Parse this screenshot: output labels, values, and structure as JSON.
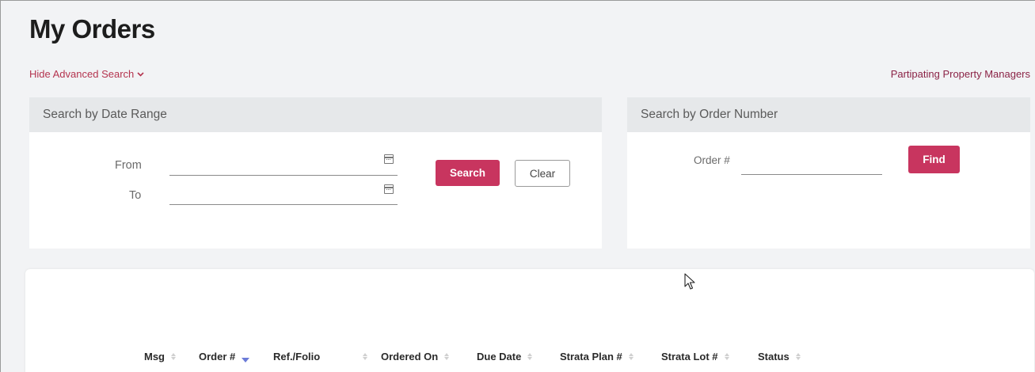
{
  "page": {
    "title": "My Orders",
    "advanced_toggle": "Hide Advanced Search",
    "property_managers_link": "Partipating Property Managers"
  },
  "date_search": {
    "heading": "Search by Date Range",
    "from_label": "From",
    "to_label": "To",
    "from_value": "",
    "to_value": "",
    "search_button": "Search",
    "clear_button": "Clear"
  },
  "order_search": {
    "heading": "Search by Order Number",
    "order_label": "Order #",
    "order_value": "",
    "find_button": "Find"
  },
  "table": {
    "columns": [
      {
        "label": "Msg",
        "sort": "none"
      },
      {
        "label": "Order #",
        "sort": "desc"
      },
      {
        "label": "Ref./Folio",
        "sort": "none"
      },
      {
        "label": "Ordered On",
        "sort": "none"
      },
      {
        "label": "Due Date",
        "sort": "none"
      },
      {
        "label": "Strata Plan #",
        "sort": "none"
      },
      {
        "label": "Strata Lot #",
        "sort": "none"
      },
      {
        "label": "Status",
        "sort": "none"
      }
    ]
  },
  "colors": {
    "accent": "#c8355f",
    "link": "#b4344f",
    "sort_active": "#6b7bd8"
  },
  "icons": {
    "toggle": "chevron-down-icon",
    "date_picker": "calendar-icon",
    "sort": "sort-icon",
    "pointer": "mouse-cursor-icon"
  }
}
